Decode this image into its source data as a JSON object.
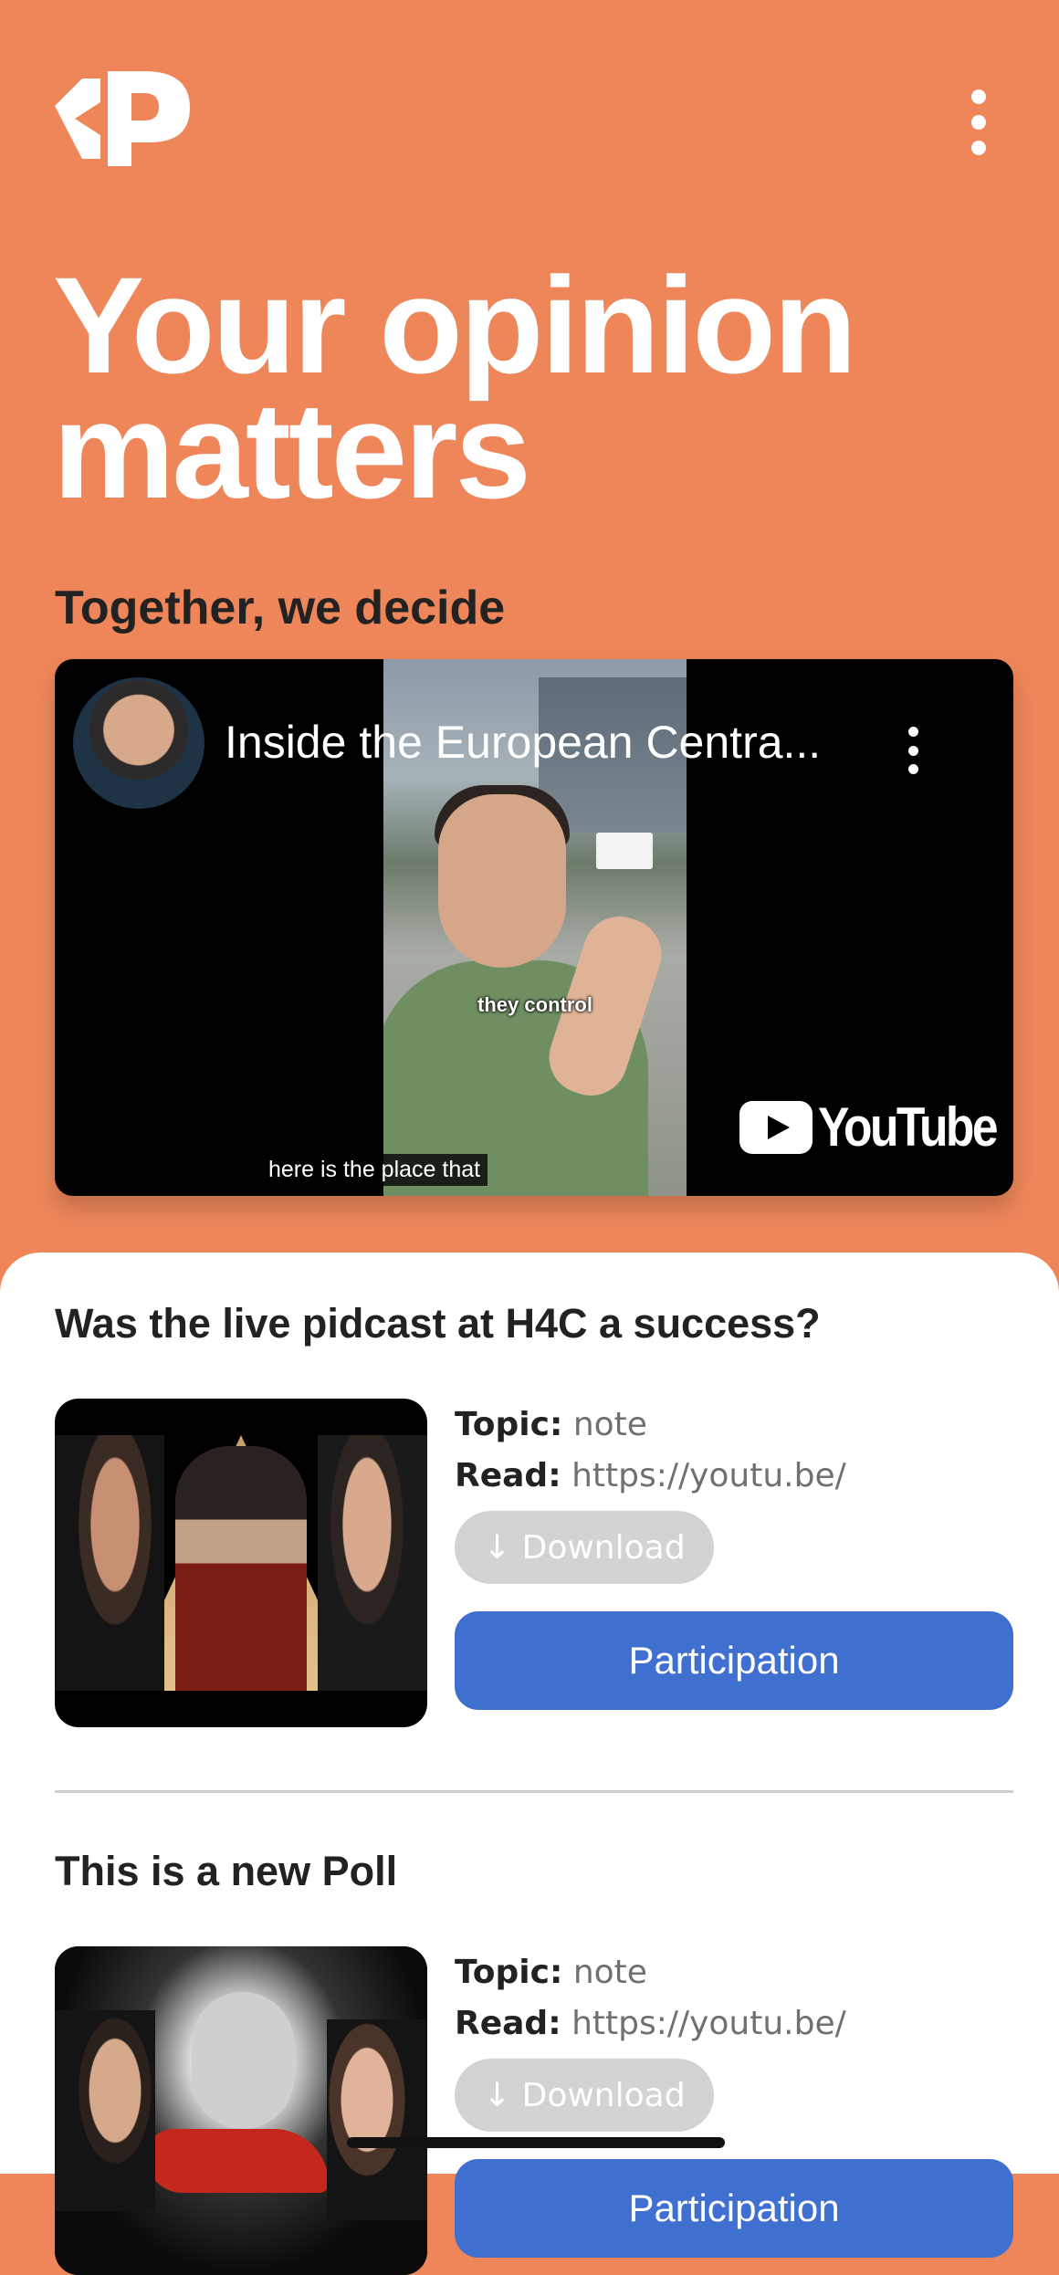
{
  "header": {
    "logo_icon": "brand-logo-icon",
    "menu_icon": "more-vertical-icon"
  },
  "hero": {
    "title": "Your opinion matters",
    "tagline": "Together, we decide"
  },
  "video": {
    "title": "Inside the European Centra...",
    "caption_in_frame": "they control",
    "subtitle": "here is the place that",
    "brand": "YouTube"
  },
  "polls": [
    {
      "title": "Was the live pidcast at H4C a success?",
      "topic_label": "Topic:",
      "topic_value": "note",
      "read_label": "Read:",
      "read_value": "https://youtu.be/",
      "download_label": "Download",
      "participation_label": "Participation"
    },
    {
      "title": "This is a new Poll",
      "topic_label": "Topic:",
      "topic_value": "note",
      "read_label": "Read:",
      "read_value": "https://youtu.be/",
      "download_label": "Download",
      "participation_label": "Participation"
    }
  ],
  "colors": {
    "background": "#EE865A",
    "accent": "#3F6FCF",
    "text": "#222222",
    "muted": "#707070"
  }
}
